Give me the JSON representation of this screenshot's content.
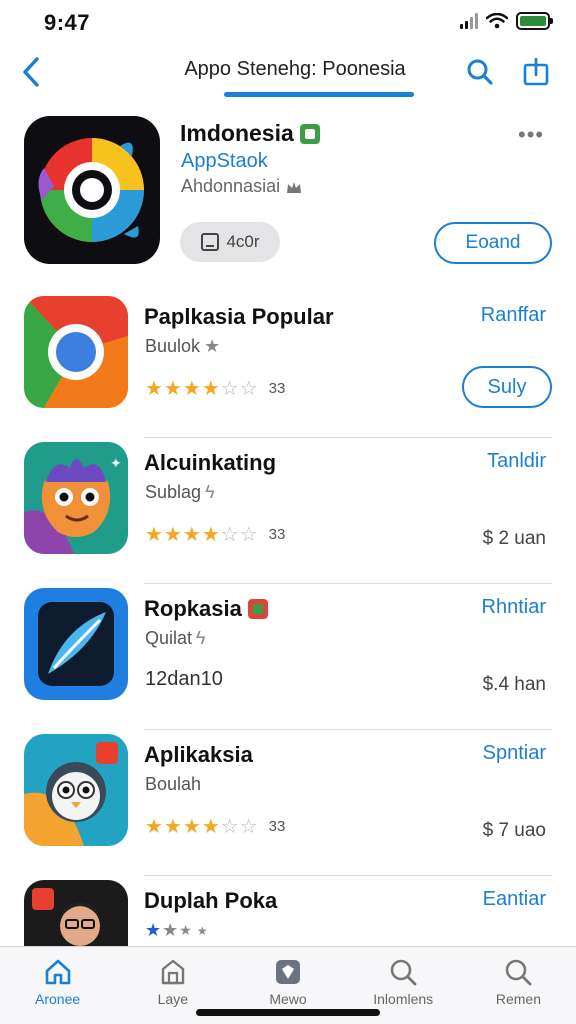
{
  "status": {
    "time": "9:47"
  },
  "nav": {
    "title": "Appo Stenehg: Poonesia"
  },
  "featured": {
    "title": "Imdonesia",
    "developer": "AppStaok",
    "subtitle": "Ahdonnasiai",
    "rating_label": "4c0r",
    "action_label": "Eoand"
  },
  "apps": [
    {
      "name": "Paplkasia Popular",
      "subtitle": "Buulok",
      "rating": 4,
      "rating_count": "33",
      "action_link": "Ranffar",
      "button_label": "Suly"
    },
    {
      "name": "Alcuinkating",
      "subtitle": "Sublag",
      "rating": 4,
      "rating_count": "33",
      "action_link": "Tanldir",
      "price": "$ 2 uan"
    },
    {
      "name": "Ropkasia",
      "subtitle": "Quilat",
      "info": "12dan10",
      "action_link": "Rhntiar",
      "price": "$.4 han"
    },
    {
      "name": "Aplikaksia",
      "subtitle": "Boulah",
      "rating": 4,
      "rating_count": "33",
      "action_link": "Spntiar",
      "price": "$ 7 uao"
    },
    {
      "name": "Duplah Poka",
      "action_link": "Eantiar"
    }
  ],
  "tabs": [
    {
      "label": "Aronee",
      "icon": "home-icon",
      "active": true
    },
    {
      "label": "Laye",
      "icon": "store-icon",
      "active": false
    },
    {
      "label": "Mewo",
      "icon": "cube-icon",
      "active": false
    },
    {
      "label": "Inlomlens",
      "icon": "search-icon",
      "active": false
    },
    {
      "label": "Remen",
      "icon": "search-icon",
      "active": false
    }
  ],
  "colors": {
    "accent": "#1a7fd6",
    "star": "#f5a623",
    "text": "#111111"
  }
}
